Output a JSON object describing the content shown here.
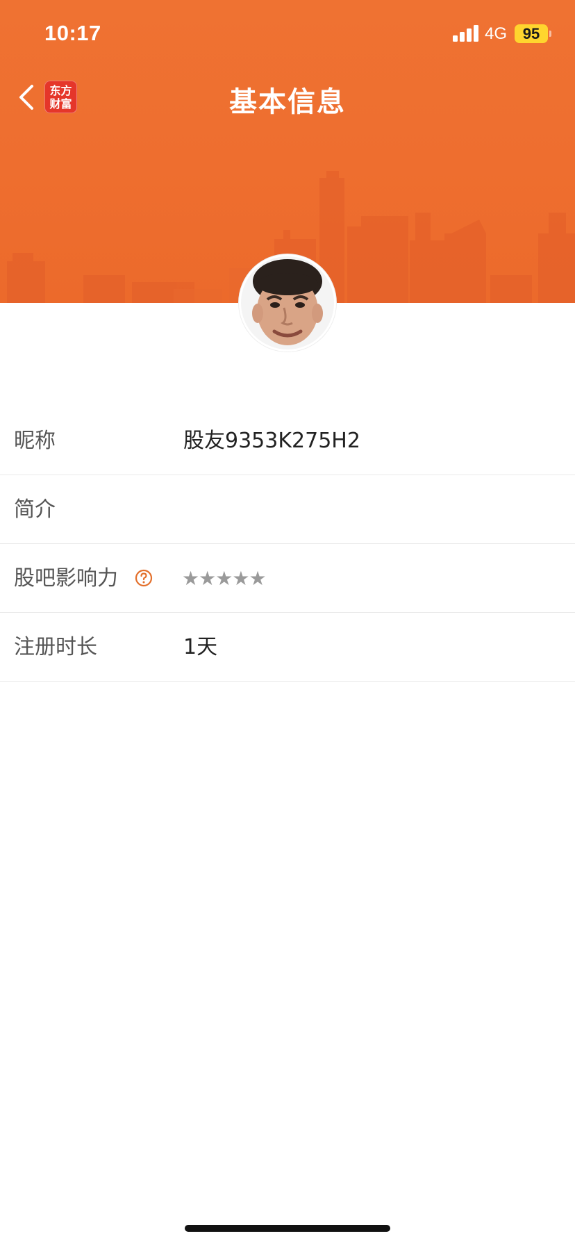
{
  "status_bar": {
    "time": "10:17",
    "network": "4G",
    "battery": "95"
  },
  "nav": {
    "logo_line1": "东方",
    "logo_line2": "财富",
    "title": "基本信息"
  },
  "profile": {
    "rows": [
      {
        "label": "昵称",
        "value": "股友9353K275H2"
      },
      {
        "label": "简介",
        "value": ""
      },
      {
        "label": "股吧影响力",
        "value": ""
      },
      {
        "label": "注册时长",
        "value": "1天"
      }
    ],
    "influence_stars_filled": 0,
    "influence_stars_total": 5
  },
  "colors": {
    "header_orange": "#ee6e2f",
    "help_icon": "#e36f2b",
    "star_gray": "#9a9a9a",
    "logo_red": "#e5362a"
  }
}
